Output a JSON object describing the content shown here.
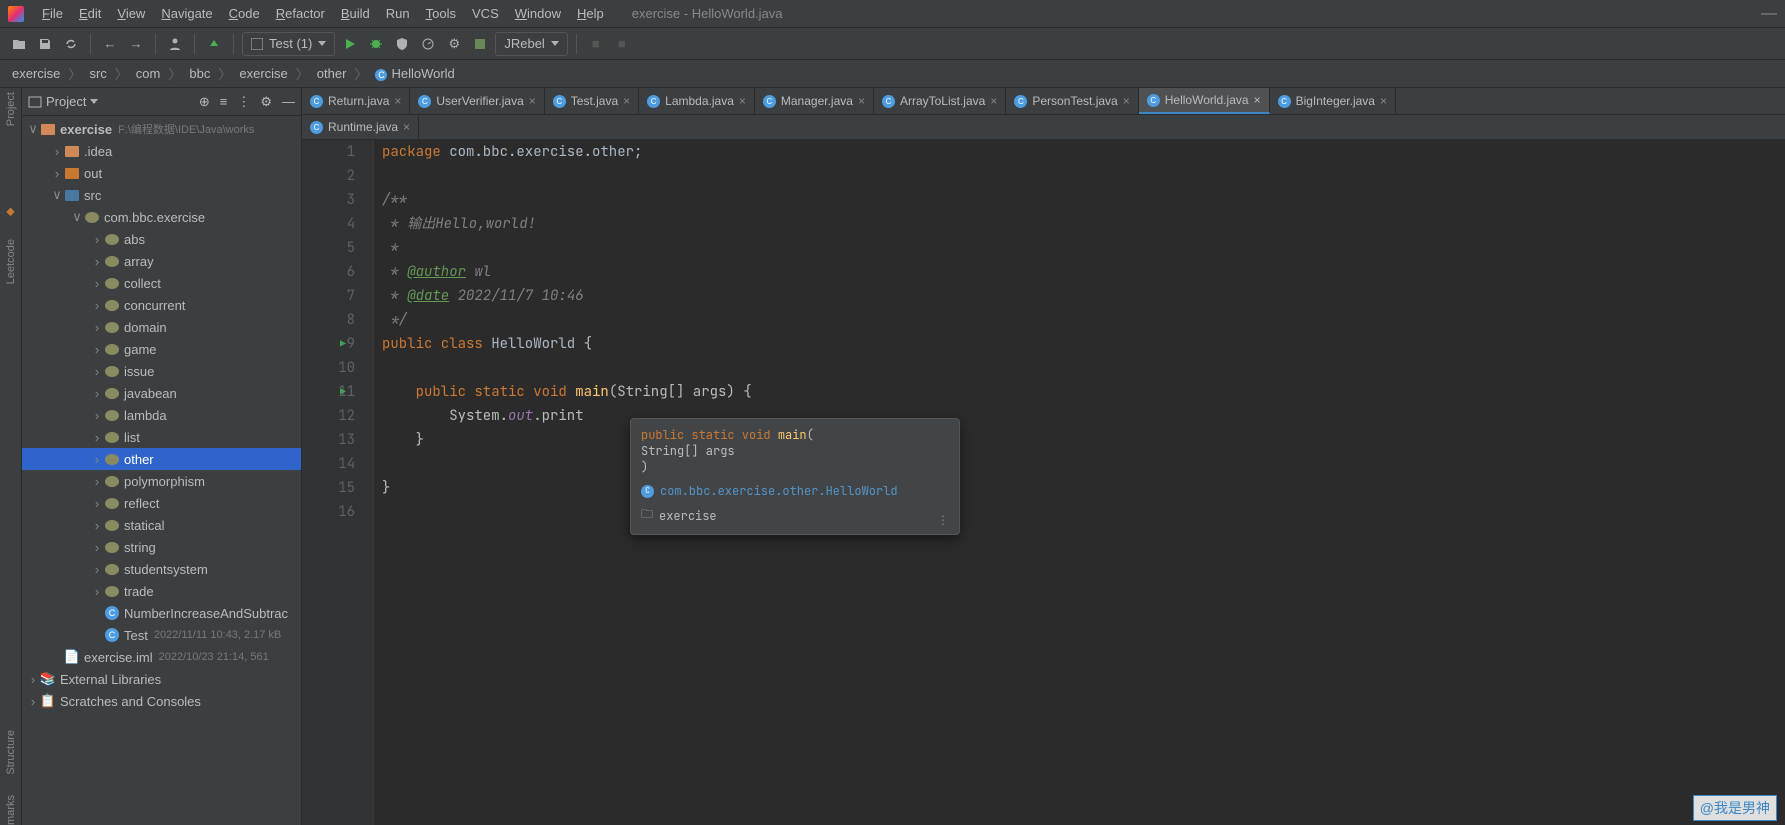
{
  "window": {
    "title": "exercise - HelloWorld.java"
  },
  "menu": {
    "file": "File",
    "edit": "Edit",
    "view": "View",
    "navigate": "Navigate",
    "code": "Code",
    "refactor": "Refactor",
    "build": "Build",
    "run": "Run",
    "tools": "Tools",
    "vcs": "VCS",
    "window": "Window",
    "help": "Help"
  },
  "toolbar": {
    "run_config": "Test (1)",
    "jrebel": "JRebel"
  },
  "breadcrumbs": [
    "exercise",
    "src",
    "com",
    "bbc",
    "exercise",
    "other",
    "HelloWorld"
  ],
  "sidebar": {
    "title": "Project",
    "root": {
      "name": "exercise",
      "path": "F:\\编程数据\\IDE\\Java\\works"
    },
    "nodes": {
      "idea": ".idea",
      "out": "out",
      "src": "src",
      "pkg": "com.bbc.exercise",
      "abs": "abs",
      "array": "array",
      "collect": "collect",
      "concurrent": "concurrent",
      "domain": "domain",
      "game": "game",
      "issue": "issue",
      "javabean": "javabean",
      "lambda": "lambda",
      "list": "list",
      "other": "other",
      "polymorphism": "polymorphism",
      "reflect": "reflect",
      "statical": "statical",
      "string": "string",
      "studentsystem": "studentsystem",
      "trade": "trade",
      "numinc": "NumberIncreaseAndSubtrac",
      "test": "Test",
      "test_meta": "2022/11/11 10:43, 2.17 kB",
      "iml": "exercise.iml",
      "iml_meta": "2022/10/23 21:14, 561",
      "extlib": "External Libraries",
      "scratches": "Scratches and Consoles"
    }
  },
  "left_gutter": {
    "project": "Project",
    "leetcode": "Leetcode",
    "structure": "Structure",
    "bookmarks": "marks"
  },
  "tabs": {
    "row1": [
      "Return.java",
      "UserVerifier.java",
      "Test.java",
      "Lambda.java",
      "Manager.java",
      "ArrayToList.java",
      "PersonTest.java",
      "HelloWorld.java",
      "BigInteger.java"
    ],
    "row2": [
      "Runtime.java"
    ],
    "active": "HelloWorld.java"
  },
  "editor": {
    "lines": [
      "1",
      "2",
      "3",
      "4",
      "5",
      "6",
      "7",
      "8",
      "9",
      "10",
      "11",
      "12",
      "13",
      "14",
      "15",
      "16"
    ],
    "code": {
      "l1a": "package ",
      "l1b": "com.bbc.exercise.other;",
      "l3": "/**",
      "l4": " * 输出Hello,world!",
      "l5": " *",
      "l6a": " * ",
      "l6b": "@author",
      "l6c": " wl",
      "l7a": " * ",
      "l7b": "@date",
      "l7c": " 2022/11/7 10:46",
      "l8": " */",
      "l9a": "public class ",
      "l9b": "HelloWorld",
      "l9c": " {",
      "l11a": "    public static void ",
      "l11b": "main",
      "l11c": "(String[] args) {",
      "l12a": "        System.",
      "l12b": "out",
      "l12c": ".print",
      "l13": "    }",
      "l15": "}"
    }
  },
  "tooltip": {
    "sig_kw": "public static void ",
    "sig_fn": "main",
    "sig_open": "(",
    "sig_args": "    String[] args",
    "sig_close": ")",
    "class_link": "com.bbc.exercise.other.HelloWorld",
    "module": "exercise"
  },
  "watermark": "@我是男神"
}
